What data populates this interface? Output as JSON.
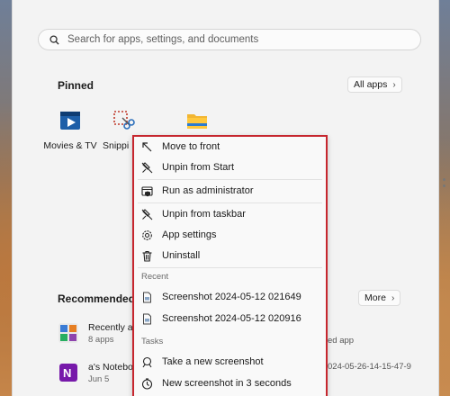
{
  "search": {
    "placeholder": "Search for apps, settings, and documents"
  },
  "pinned": {
    "title": "Pinned",
    "all_apps_label": "All apps",
    "apps": [
      {
        "label": "Movies & TV",
        "icon": "movies-tv-icon"
      },
      {
        "label": "Snippi",
        "icon": "snipping-tool-icon"
      },
      {
        "label": "",
        "icon": "file-explorer-icon"
      }
    ]
  },
  "recommended": {
    "title": "Recommended",
    "more_label": "More",
    "items": [
      {
        "name": "Recently add",
        "sub": "8 apps",
        "right": "ed app"
      },
      {
        "name": "a's Notebo",
        "sub": "Jun 5",
        "right": "024-05-26-14-15-47-9"
      }
    ]
  },
  "context_menu": {
    "items": [
      {
        "label": "Move to front",
        "icon": "move-to-front-icon"
      },
      {
        "label": "Unpin from Start",
        "icon": "unpin-icon"
      },
      {
        "label": "Run as administrator",
        "icon": "shield-admin-icon"
      },
      {
        "label": "Unpin from taskbar",
        "icon": "unpin-taskbar-icon"
      },
      {
        "label": "App settings",
        "icon": "gear-icon"
      },
      {
        "label": "Uninstall",
        "icon": "trash-icon"
      }
    ],
    "recent_header": "Recent",
    "recent": [
      {
        "label": "Screenshot 2024-05-12 021649",
        "icon": "file-icon"
      },
      {
        "label": "Screenshot 2024-05-12 020916",
        "icon": "file-icon"
      }
    ],
    "tasks_header": "Tasks",
    "tasks": [
      {
        "label": "Take a new screenshot",
        "icon": "snip-icon"
      },
      {
        "label": "New screenshot in 3 seconds",
        "icon": "timer-icon"
      }
    ]
  },
  "colors": {
    "highlight_border": "#c6262e",
    "menu_background": "#f3f3f3"
  }
}
